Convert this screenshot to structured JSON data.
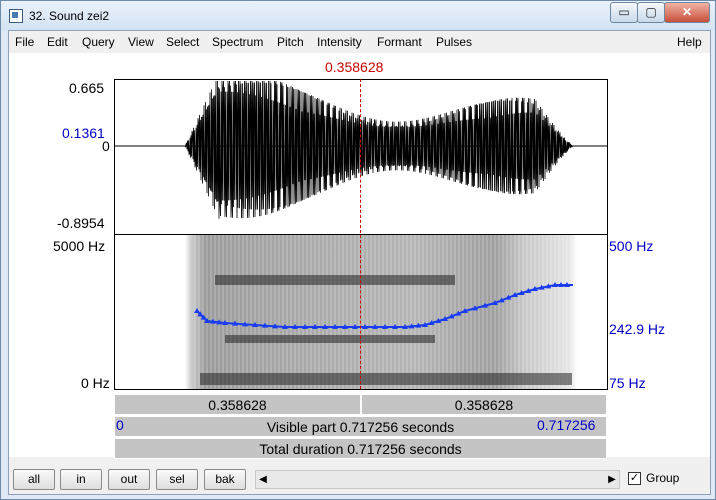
{
  "window": {
    "title": "32. Sound zei2"
  },
  "window_controls": {
    "minimize": "▭",
    "maximize": "▢",
    "close": "✕"
  },
  "menu": [
    "File",
    "Edit",
    "Query",
    "View",
    "Select",
    "Spectrum",
    "Pitch",
    "Intensity",
    "Formant",
    "Pulses"
  ],
  "help_menu": "Help",
  "cursor_time": "0.358628",
  "waveform": {
    "max": "0.665",
    "cursor_value": "0.1361",
    "zero": "0",
    "min": "-0.8954"
  },
  "spectrogram": {
    "top_freq": "5000 Hz",
    "bottom_freq": "0 Hz"
  },
  "pitch_axis": {
    "top": "500 Hz",
    "mid": "242.9 Hz",
    "bottom": "75 Hz"
  },
  "selection_left": "0.358628",
  "selection_right": "0.358628",
  "visible_start": "0",
  "visible_part": "Visible part 0.717256 seconds",
  "visible_end": "0.717256",
  "total_duration": "Total duration 0.717256 seconds",
  "buttons": {
    "all": "all",
    "in": "in",
    "out": "out",
    "sel": "sel",
    "bak": "bak"
  },
  "scroll": {
    "left_arrow": "◀",
    "right_arrow": "▶"
  },
  "group": {
    "label": "Group",
    "checked": "✓"
  },
  "colors": {
    "pitch_curve": "#1a3cf0",
    "cursor": "#c80000",
    "axis_blue": "#0000c8"
  }
}
